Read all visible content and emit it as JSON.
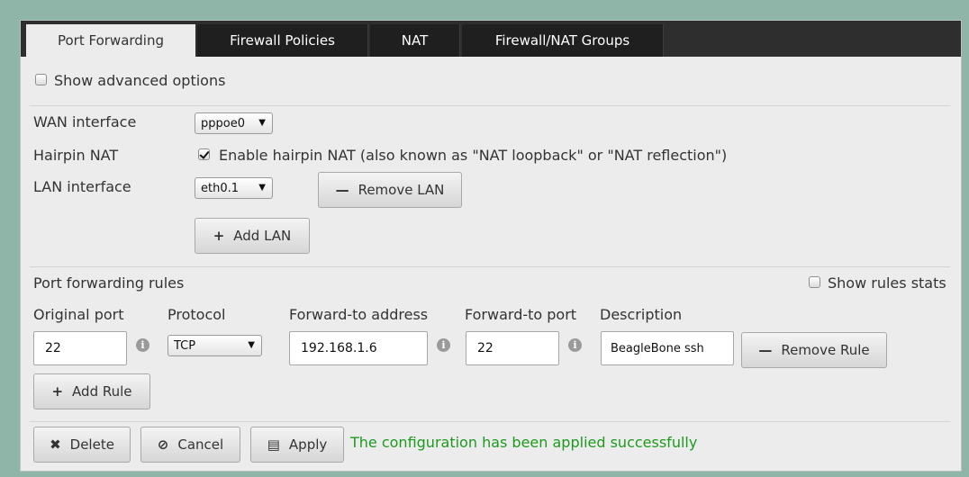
{
  "tabs": [
    "Port Forwarding",
    "Firewall Policies",
    "NAT",
    "Firewall/NAT Groups"
  ],
  "show_advanced_label": "Show advanced options",
  "wan": {
    "label": "WAN interface",
    "value": "pppoe0"
  },
  "hairpin": {
    "label": "Hairpin NAT",
    "checkbox_label": "Enable hairpin NAT (also known as \"NAT loopback\" or \"NAT reflection\")",
    "checked": true
  },
  "lan": {
    "label": "LAN interface",
    "value": "eth0.1",
    "remove_label": "Remove LAN",
    "add_label": "Add LAN"
  },
  "rules": {
    "title": "Port forwarding rules",
    "show_stats_label": "Show rules stats",
    "columns": [
      "Original port",
      "Protocol",
      "Forward-to address",
      "Forward-to port",
      "Description"
    ],
    "row": {
      "original_port": "22",
      "protocol": "TCP",
      "forward_address": "192.168.1.6",
      "forward_port": "22",
      "description": "BeagleBone ssh",
      "remove_label": "Remove Rule"
    },
    "add_label": "Add Rule"
  },
  "footer": {
    "delete_label": "Delete",
    "cancel_label": "Cancel",
    "apply_label": "Apply",
    "status": "The configuration has been applied successfully",
    "status_color": "#1d9a1d"
  },
  "icons": {
    "info": "info-icon",
    "minus": "minus-icon",
    "plus": "plus-icon",
    "delete": "x-icon",
    "cancel": "cancel-icon",
    "apply": "save-icon"
  }
}
